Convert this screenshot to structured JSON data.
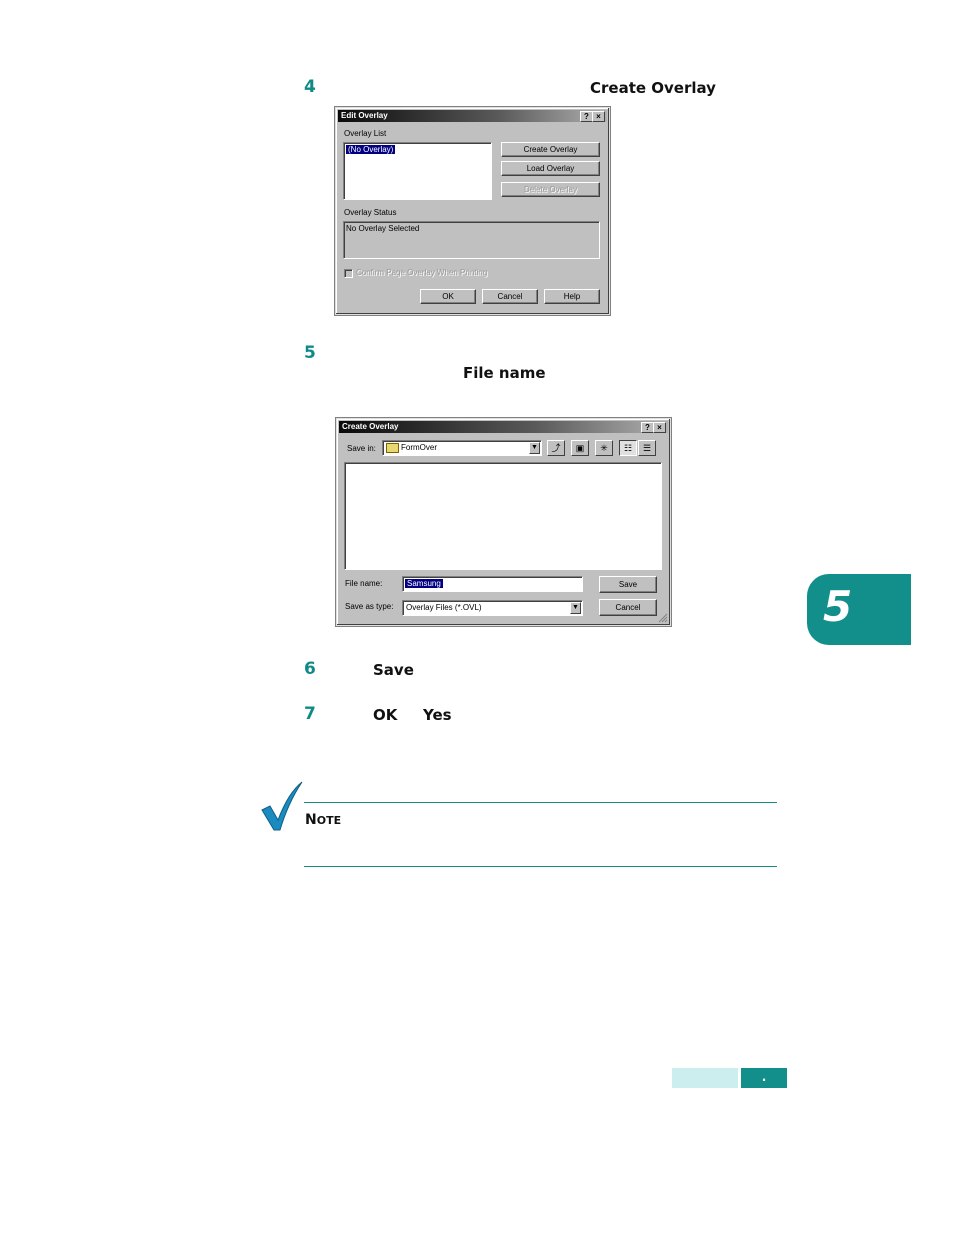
{
  "steps": [
    {
      "number": "4",
      "bold": "Create Overlay"
    },
    {
      "number": "5",
      "bold": "File name"
    },
    {
      "number": "6",
      "bold": "Save"
    },
    {
      "number": "7",
      "bold_a": "OK",
      "bold_b": "Yes"
    }
  ],
  "edit_overlay": {
    "title": "Edit Overlay",
    "help_glyph": "?",
    "close_glyph": "×",
    "overlay_list_label": "Overlay List",
    "list_item": "(No Overlay)",
    "create_label": "Create Overlay",
    "load_label": "Load Overlay",
    "delete_label": "Delete Overlay",
    "status_label": "Overlay Status",
    "status_value": "No Overlay Selected",
    "confirm_label": "Confirm Page Overlay When Printing",
    "ok_label": "OK",
    "cancel_label": "Cancel",
    "help_label": "Help"
  },
  "create_overlay": {
    "title": "Create Overlay",
    "help_glyph": "?",
    "close_glyph": "×",
    "save_in_label": "Save in:",
    "save_in_value": "FormOver",
    "file_name_label": "File name:",
    "file_name_value": "Samsung",
    "save_type_label": "Save as type:",
    "save_type_value": "Overlay Files (*.OVL)",
    "save_label": "Save",
    "cancel_label": "Cancel",
    "arrow_glyph": "▼"
  },
  "note": {
    "label_first": "N",
    "label_rest": "OTE"
  },
  "chapter_tab": "5",
  "footer": {
    "page_marker": "."
  },
  "colors": {
    "accent_teal": "#0f8a86",
    "footer_light": "#cdeeee",
    "footer_dark": "#128f8a"
  },
  "icons": [
    "check-mark-icon",
    "folder-icon",
    "up-folder-icon",
    "desktop-icon",
    "new-folder-icon",
    "list-view-icon",
    "details-view-icon",
    "size-grip-icon"
  ]
}
